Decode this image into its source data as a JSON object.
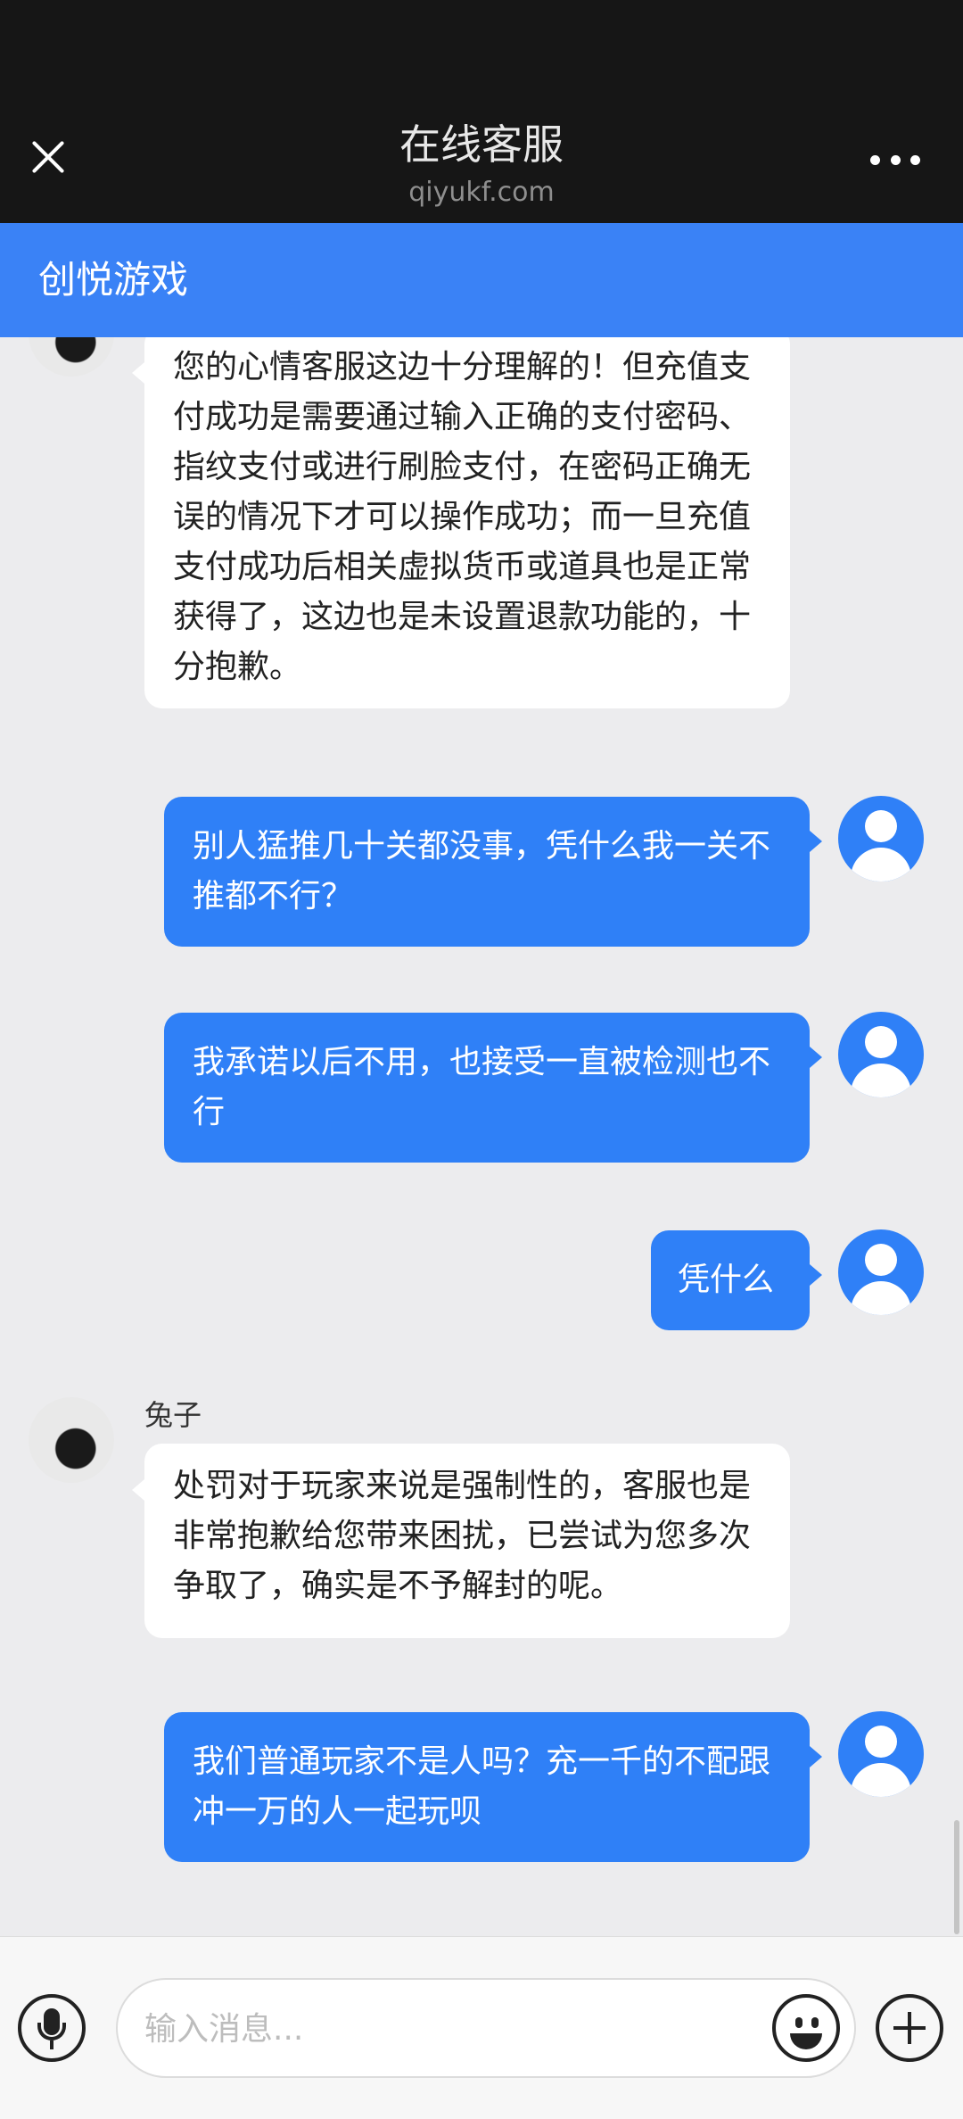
{
  "titlebar": {
    "title": "在线客服",
    "subtitle": "qiyukf.com"
  },
  "header": {
    "title": "创悦游戏"
  },
  "messages": [
    {
      "from": "agent",
      "text": "您的心情客服这边十分理解的！但充值支付成功是需要通过输入正确的支付密码、指纹支付或进行刷脸支付，在密码正确无误的情况下才可以操作成功；而一旦充值支付成功后相关虚拟货币或道具也是正常获得了，这边也是未设置退款功能的，十分抱歉。"
    },
    {
      "from": "user",
      "text": "别人猛推几十关都没事，凭什么我一关不推都不行？"
    },
    {
      "from": "user",
      "text": "我承诺以后不用，也接受一直被检测也不行"
    },
    {
      "from": "user",
      "text": "凭什么"
    },
    {
      "from": "agent",
      "name": "兔子",
      "text": "处罚对于玩家来说是强制性的，客服也是非常抱歉给您带来困扰，已尝试为您多次争取了，确实是不予解封的呢。"
    },
    {
      "from": "user",
      "text": "我们普通玩家不是人吗？充一千的不配跟冲一万的人一起玩呗"
    }
  ],
  "input": {
    "placeholder": "输入消息..."
  },
  "icons": {
    "close": "close-icon",
    "more": "more-dots-icon",
    "mic": "microphone-icon",
    "emoji": "emoji-icon",
    "plus": "plus-icon",
    "user_avatar": "user-avatar-icon"
  },
  "colors": {
    "titlebar": "#161616",
    "accent": "#3a82f6",
    "user_bubble": "#2f80f7",
    "chat_bg": "#ececee"
  }
}
